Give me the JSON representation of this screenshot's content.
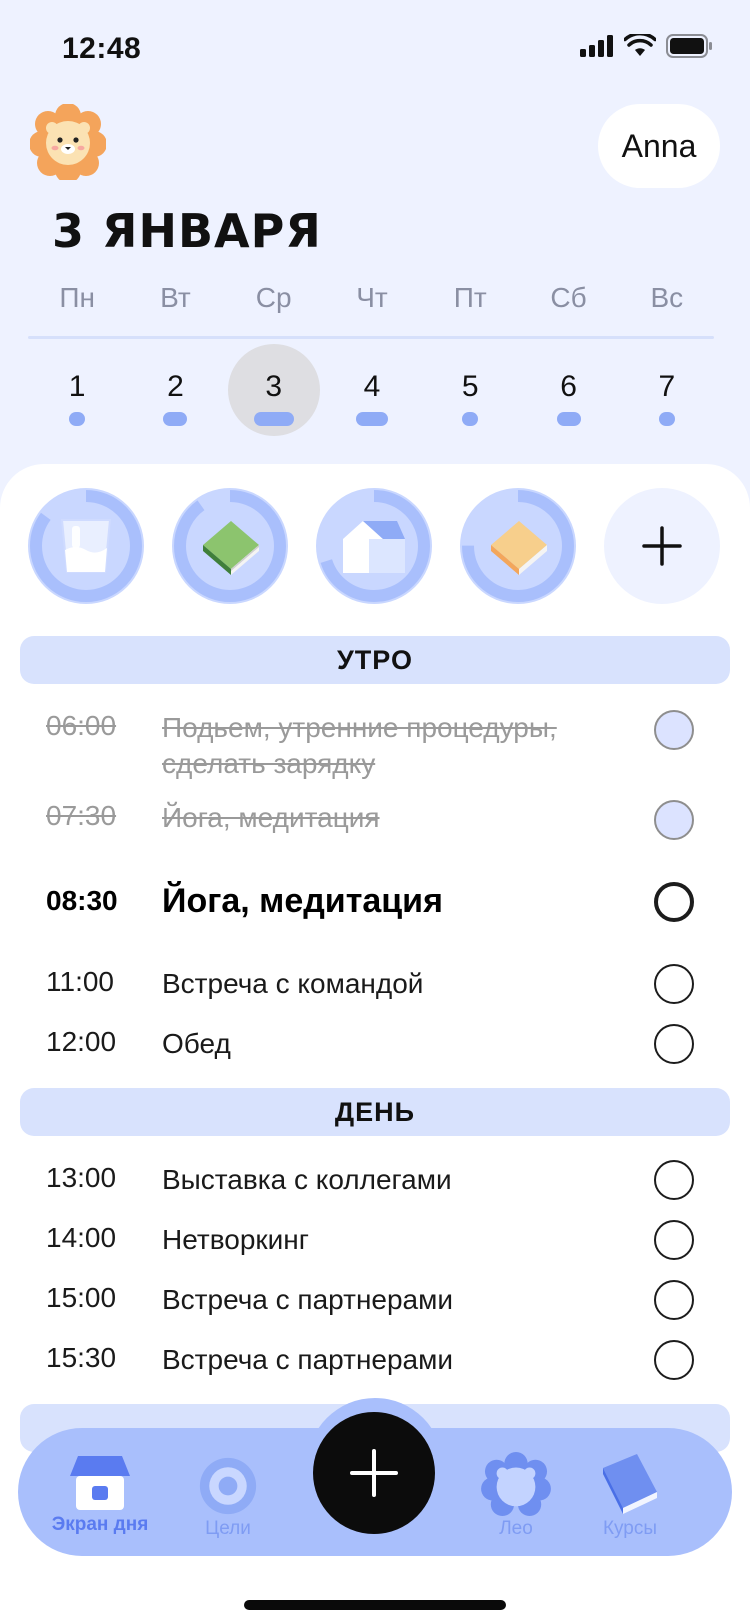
{
  "status_bar": {
    "time": "12:48"
  },
  "header": {
    "user_name": "Anna",
    "date_title": "3 ЯНВАРЯ"
  },
  "week": {
    "weekdays": [
      "Пн",
      "Вт",
      "Ср",
      "Чт",
      "Пт",
      "Сб",
      "Вс"
    ],
    "days": [
      "1",
      "2",
      "3",
      "4",
      "5",
      "6",
      "7"
    ],
    "selected_day": "3"
  },
  "habits": [
    {
      "icon": "water-glass-icon",
      "progress": 0.85
    },
    {
      "icon": "green-book-icon",
      "progress": 0.9
    },
    {
      "icon": "house-icon",
      "progress": 0.7
    },
    {
      "icon": "orange-book-icon",
      "progress": 0.75
    },
    {
      "icon": "plus-icon"
    }
  ],
  "sections": {
    "morning": "УТРО",
    "day": "ДЕНЬ"
  },
  "tasks_morning": [
    {
      "time": "06:00",
      "title": "Подьем, утренние процедуры, сделать зарядку",
      "state": "done"
    },
    {
      "time": "07:30",
      "title": "Йога, медитация",
      "state": "done"
    },
    {
      "time": "08:30",
      "title": "Йога, медитация",
      "state": "active"
    },
    {
      "time": "11:00",
      "title": "Встреча с командой",
      "state": "todo"
    },
    {
      "time": "12:00",
      "title": "Обед",
      "state": "todo"
    }
  ],
  "tasks_day": [
    {
      "time": "13:00",
      "title": "Выставка с коллегами",
      "state": "todo"
    },
    {
      "time": "14:00",
      "title": "Нетворкинг",
      "state": "todo"
    },
    {
      "time": "15:00",
      "title": "Встреча с партнерами",
      "state": "todo"
    },
    {
      "time": "15:30",
      "title": "Встреча с партнерами",
      "state": "todo"
    }
  ],
  "nav": {
    "home": "Экран дня",
    "goals": "Цели",
    "leo": "Лео",
    "courses": "Курсы"
  },
  "colors": {
    "accent": "#a9bffc",
    "accent_dark": "#5a7bf0",
    "section_bg": "#d8e2fd",
    "background": "#eef2ff"
  }
}
